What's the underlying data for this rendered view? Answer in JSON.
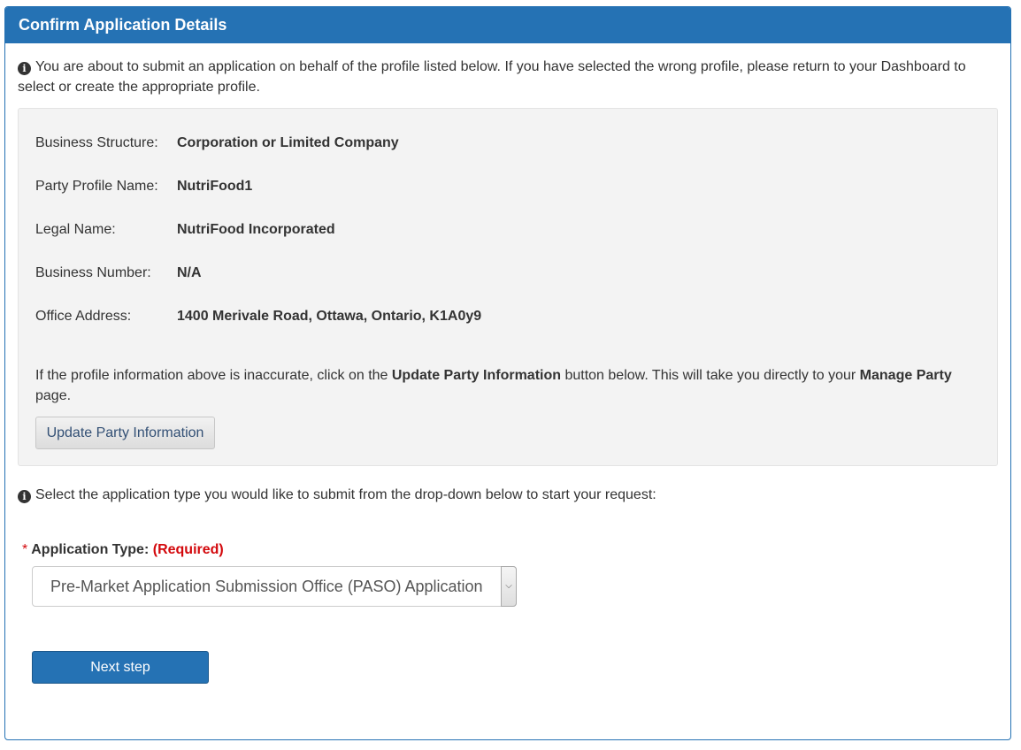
{
  "panel": {
    "title": "Confirm Application Details"
  },
  "intro": {
    "text": "You are about to submit an application on behalf of the profile listed below. If you have selected the wrong profile, please return to your Dashboard to select or create the appropriate profile."
  },
  "profile": {
    "rows": [
      {
        "label": "Business Structure:",
        "value": "Corporation or Limited Company"
      },
      {
        "label": "Party Profile Name:",
        "value": "NutriFood1"
      },
      {
        "label": "Legal Name:",
        "value": "NutriFood Incorporated"
      },
      {
        "label": "Business Number:",
        "value": "N/A"
      },
      {
        "label": "Office Address:",
        "value": "1400 Merivale Road, Ottawa, Ontario, K1A0y9"
      }
    ],
    "note_part1": "If the profile information above is inaccurate, click on the ",
    "note_bold1": "Update Party Information",
    "note_part2": " button below. This will take you directly to your ",
    "note_bold2": "Manage Party",
    "note_part3": " page.",
    "update_button_label": "Update Party Information"
  },
  "select_intro": {
    "text": "Select the application type you would like to submit from the drop-down below to start your request:"
  },
  "application_type": {
    "required_marker": "*",
    "label": "Application Type:",
    "required_text": "(Required)",
    "selected_value": "Pre-Market Application Submission Office (PASO) Application"
  },
  "next_button_label": "Next step",
  "icons": {
    "info": "info-icon",
    "dropdown": "chevron-down-icon"
  },
  "colors": {
    "primary": "#2572b4",
    "required": "#d3080c",
    "profile_bg": "#f3f3f3"
  }
}
